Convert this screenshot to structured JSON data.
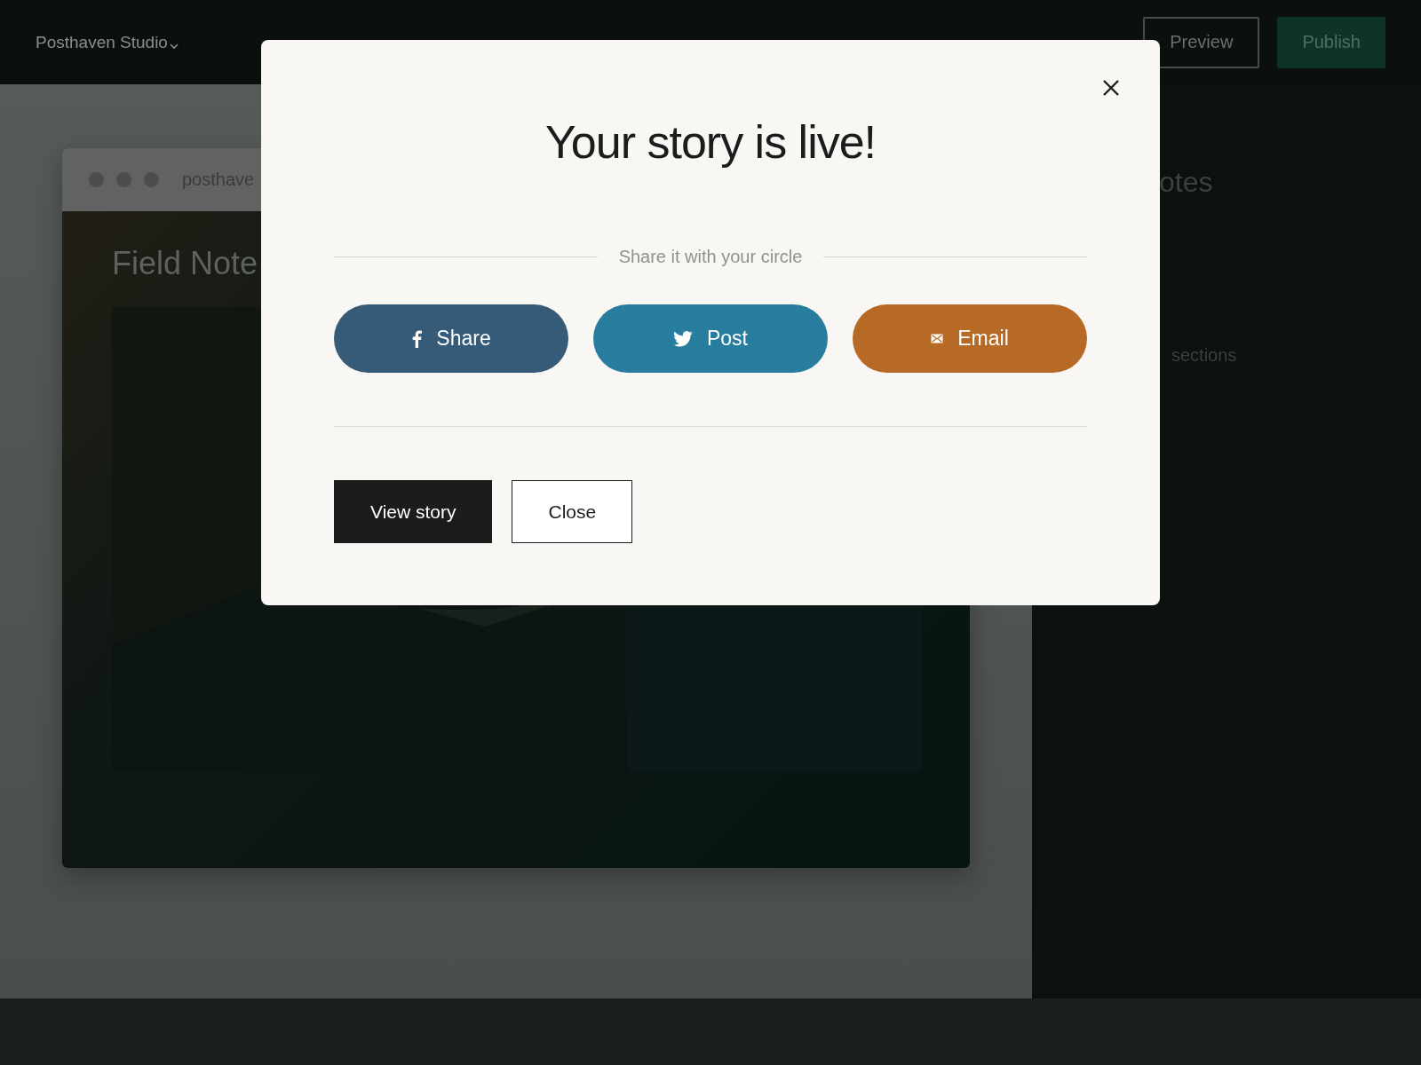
{
  "top_bar": {
    "brand": "Posthaven Studio",
    "buttons": [
      {
        "label": "Preview",
        "kind": "outline"
      },
      {
        "label": "Publish",
        "kind": "primary"
      }
    ]
  },
  "preview": {
    "address": "posthave",
    "heading": "Field Note"
  },
  "side_panel": {
    "title": "otes",
    "line": "sections"
  },
  "dialog": {
    "title": "Your story is live!",
    "share_label": "Share it with your circle",
    "share_buttons": [
      {
        "label": "Share",
        "kind": "facebook",
        "color": "#365b78"
      },
      {
        "label": "Post",
        "kind": "twitter",
        "color": "#287d9f"
      },
      {
        "label": "Email",
        "kind": "email",
        "color": "#b66a25"
      }
    ],
    "actions": [
      {
        "label": "View story",
        "kind": "primary"
      },
      {
        "label": "Close",
        "kind": "secondary"
      }
    ]
  }
}
